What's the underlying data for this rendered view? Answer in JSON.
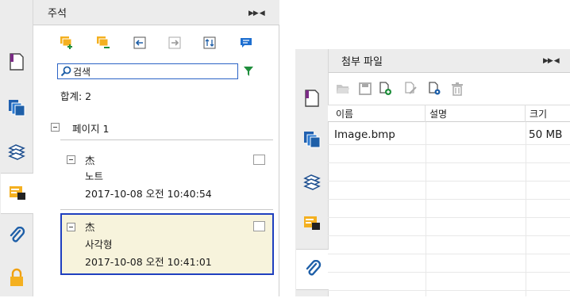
{
  "comments_panel": {
    "title": "주석",
    "toolbar_icons": [
      "add-comment-icon",
      "add-reply-icon",
      "import-icon",
      "export-icon",
      "sort-icon",
      "chat-icon"
    ],
    "search_placeholder": "검색",
    "filter_icon": "filter-icon",
    "total_label": "합계: 2",
    "page_group_label": "페이지 1",
    "items": [
      {
        "author": "杰",
        "type": "노트",
        "timestamp": "2017-10-08 오전 10:40:54",
        "selected": false
      },
      {
        "author": "杰",
        "type": "사각형",
        "timestamp": "2017-10-08 오전 10:41:01",
        "selected": true
      }
    ]
  },
  "left_rail": {
    "tabs": [
      "page-icon",
      "pages-icon",
      "layers-icon",
      "comments-icon",
      "attachment-icon",
      "lock-icon"
    ],
    "active": "comments-icon"
  },
  "attachments_panel": {
    "title": "첨부 파일",
    "toolbar_icons": [
      "open-folder-icon",
      "save-icon",
      "add-file-icon",
      "edit-description-icon",
      "settings-file-icon",
      "delete-icon"
    ],
    "columns": [
      "이름",
      "설명",
      "크기"
    ],
    "rows": [
      {
        "name": "Image.bmp",
        "description": "",
        "size": "50 MB"
      }
    ]
  },
  "right_rail": {
    "tabs": [
      "page-icon",
      "pages-icon",
      "layers-icon",
      "comments-icon",
      "attachment-icon"
    ],
    "active": "attachment-icon"
  },
  "colors": {
    "selected_bg": "#f7f3dc",
    "selected_border": "#1f3fbf",
    "accent_green": "#1f8e3c",
    "comment_orange": "#f4b020"
  }
}
